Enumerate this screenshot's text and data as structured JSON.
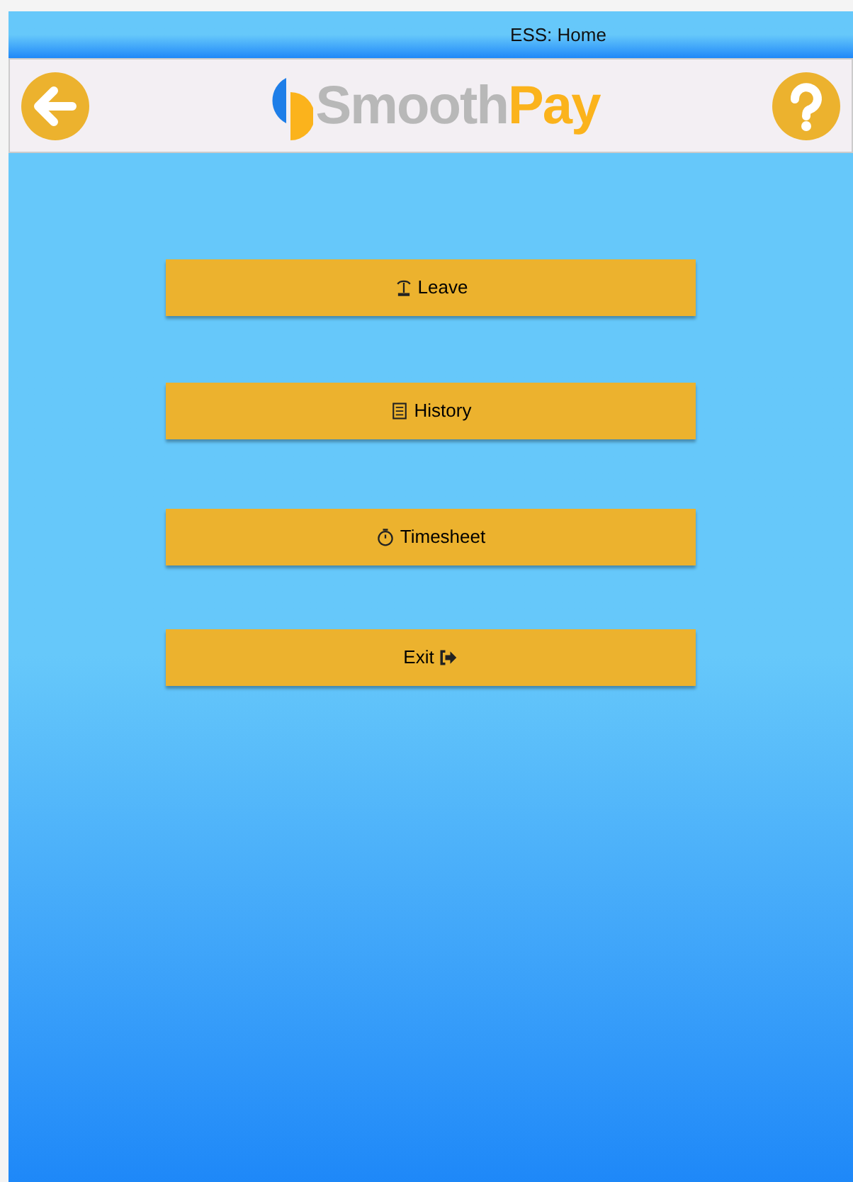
{
  "window": {
    "title": "ESS: Home"
  },
  "header": {
    "logo": {
      "part_1": "Smooth",
      "part_2": "Pay"
    }
  },
  "menu": [
    {
      "kind": "leave",
      "label": "Leave"
    },
    {
      "kind": "history",
      "label": "History"
    },
    {
      "kind": "timesheet",
      "label": "Timesheet"
    },
    {
      "kind": "exit",
      "label": "Exit"
    }
  ]
}
